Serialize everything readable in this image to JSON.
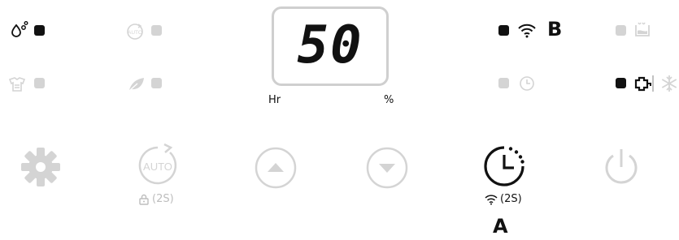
{
  "display": {
    "value": "50",
    "unit_left": "Hr",
    "unit_right": "%"
  },
  "indicators": {
    "water_full": {
      "icon": "water-drops-icon",
      "state": "on"
    },
    "auto_mode": {
      "icon": "auto-mode-icon",
      "icon_text": "AUTO",
      "state": "off"
    },
    "drying": {
      "icon": "clothes-drying-icon",
      "state": "off"
    },
    "eco": {
      "icon": "leaf-icon",
      "state": "off"
    },
    "wifi": {
      "icon": "wifi-icon",
      "state": "on"
    },
    "timer": {
      "icon": "timer-icon",
      "state": "off"
    },
    "tank": {
      "icon": "tank-icon",
      "state": "off"
    },
    "pump": {
      "icon": "pump-icon",
      "state": "on"
    },
    "defrost": {
      "icon": "snowflake-icon",
      "state": "off"
    }
  },
  "annotations": {
    "a": "A",
    "b": "B"
  },
  "buttons": {
    "settings": {
      "icon": "gear-icon"
    },
    "auto": {
      "icon": "auto-button-icon",
      "icon_text": "AUTO",
      "sub": "(2S)",
      "sub_icon": "lock-icon"
    },
    "up": {
      "icon": "arrow-up-icon"
    },
    "down": {
      "icon": "arrow-down-icon"
    },
    "timer": {
      "icon": "timer-button-icon",
      "sub": "(2S)",
      "sub_icon": "wifi-icon"
    },
    "power": {
      "icon": "power-icon"
    }
  },
  "colors": {
    "active": "#111111",
    "inactive": "#d4d4d4",
    "display_border": "#cfcfcf"
  }
}
